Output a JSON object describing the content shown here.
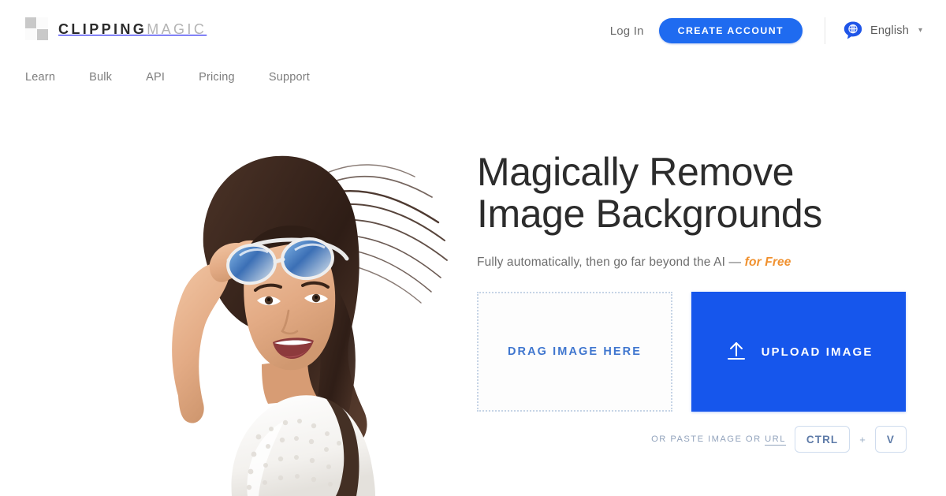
{
  "header": {
    "logo": {
      "word_bold": "CLIPPING",
      "word_light": "MAGIC",
      "icon": "checkerboard-icon"
    },
    "nav": [
      {
        "label": "Learn"
      },
      {
        "label": "Bulk"
      },
      {
        "label": "API"
      },
      {
        "label": "Pricing"
      },
      {
        "label": "Support"
      }
    ],
    "login_label": "Log In",
    "create_account_label": "CREATE ACCOUNT",
    "language": {
      "label": "English",
      "icon": "globe-speech-bubble-icon",
      "chevron": "▾"
    }
  },
  "hero": {
    "photo_alt": "smiling woman with sunglasses on head and windblown hair",
    "headline_line1": "Magically Remove",
    "headline_line2": "Image Backgrounds",
    "subhead_prefix": "Fully automatically, then go far beyond the AI — ",
    "subhead_highlight": "for Free",
    "drag_label": "DRAG IMAGE HERE",
    "upload_label": "UPLOAD IMAGE",
    "upload_icon": "upload-arrow-icon",
    "paste_prefix": "OR PASTE IMAGE OR ",
    "paste_url_word": "URL",
    "key_ctrl": "CTRL",
    "key_plus": "+",
    "key_v": "V"
  },
  "colors": {
    "accent_blue": "#1656ec",
    "button_blue": "#1f6bf0",
    "highlight_orange": "#f0912f",
    "drag_text_blue": "#3f76cf",
    "key_border": "#cfdcee",
    "muted_text": "#93a4bd"
  }
}
